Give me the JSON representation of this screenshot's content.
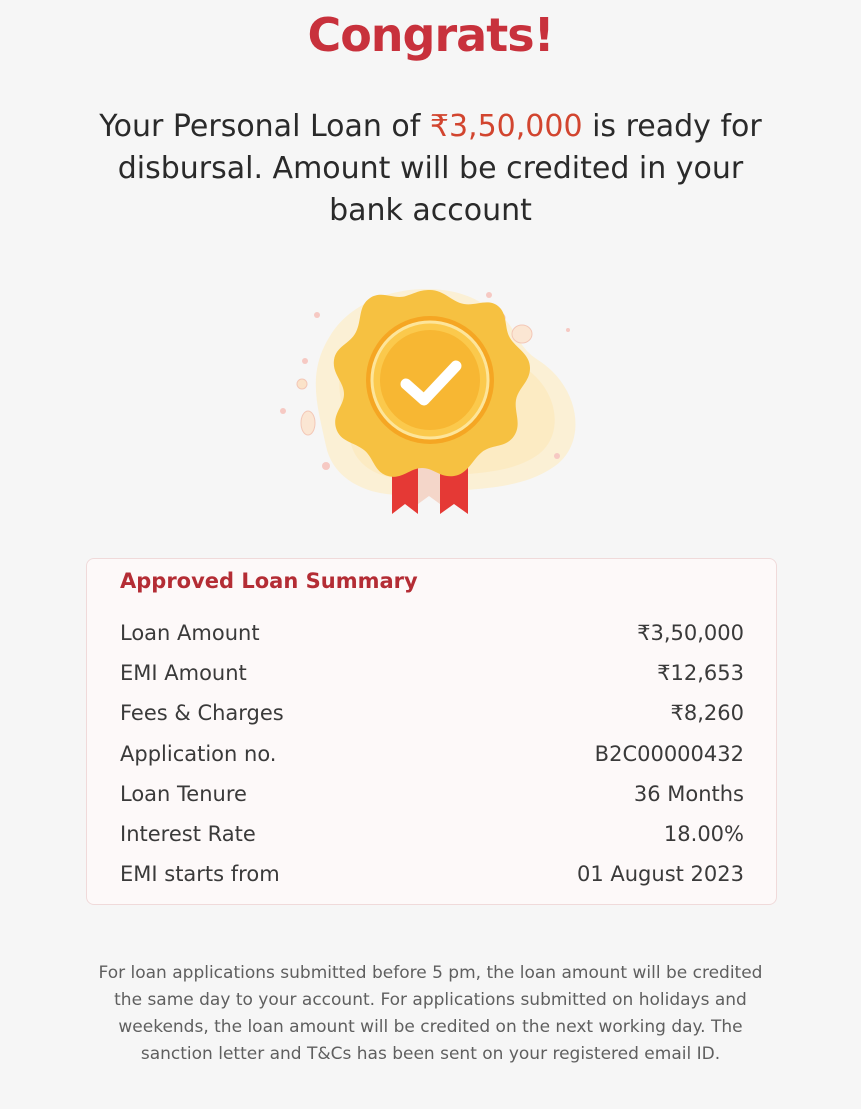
{
  "header": {
    "title": "Congrats!",
    "message_prefix": "Your Personal Loan of ",
    "message_amount": "₹3,50,000",
    "message_suffix": " is ready for disbursal. Amount will be credited in your bank account"
  },
  "badge": {
    "icon": "award-badge-checkmark-icon"
  },
  "summary": {
    "title": "Approved Loan Summary",
    "rows": [
      {
        "label": "Loan Amount",
        "value": "₹3,50,000"
      },
      {
        "label": "EMI Amount",
        "value": "₹12,653"
      },
      {
        "label": "Fees & Charges",
        "value": "₹8,260"
      },
      {
        "label": "Application no.",
        "value": "B2C00000432"
      },
      {
        "label": "Loan Tenure",
        "value": "36 Months"
      },
      {
        "label": "Interest Rate",
        "value": "18.00%"
      },
      {
        "label": "EMI starts from",
        "value": "01 August 2023"
      }
    ]
  },
  "footnote": "For loan applications submitted before 5 pm, the loan amount will be credited the same day to your account. For applications submitted on holidays and weekends, the loan amount will be credited on the next working day. The sanction letter and T&Cs has been sent on your registered email ID.",
  "colors": {
    "brand_red": "#c8313c",
    "amount_orange": "#d2452f",
    "badge_gold": "#f6c141",
    "ribbon_red": "#e53935"
  }
}
